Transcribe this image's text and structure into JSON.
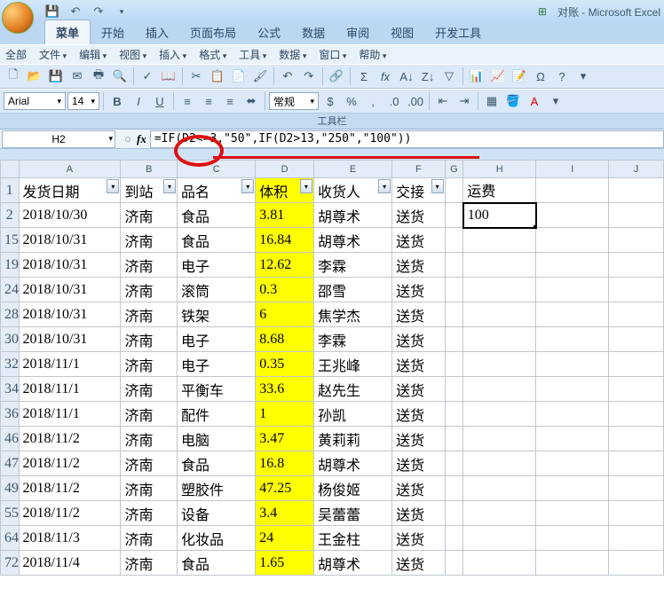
{
  "app": {
    "title_doc": "对账",
    "title_app": "Microsoft Excel"
  },
  "qat": {
    "icons": [
      "excel",
      "save",
      "undo",
      "redo",
      "down"
    ]
  },
  "ribbon": {
    "tabs": [
      "菜单",
      "开始",
      "插入",
      "页面布局",
      "公式",
      "数据",
      "审阅",
      "视图",
      "开发工具"
    ],
    "active": 0
  },
  "menu": [
    "全部",
    "文件",
    "编辑",
    "视图",
    "插入",
    "格式",
    "工具",
    "数据",
    "窗口",
    "帮助"
  ],
  "font": {
    "name": "Arial",
    "size": "14"
  },
  "toolbar_title": "工具栏",
  "number_format": "常规",
  "name_box": "H2",
  "formula": "=IF(D2<=3,\"50\",IF(D2>13,\"250\",\"100\"))",
  "headers": {
    "A": "发货日期",
    "B": "到站",
    "C": "品名",
    "D": "体积",
    "E": "收货人",
    "F": "交接",
    "H": "运费"
  },
  "columns": [
    "",
    "A",
    "B",
    "C",
    "D",
    "E",
    "F",
    "G",
    "H",
    "I",
    "J"
  ],
  "rows": [
    {
      "n": "2",
      "A": "2018/10/30",
      "B": "济南",
      "C": "食品",
      "D": "3.81",
      "E": "胡尊术",
      "F": "送货",
      "H": "100"
    },
    {
      "n": "15",
      "A": "2018/10/31",
      "B": "济南",
      "C": "食品",
      "D": "16.84",
      "E": "胡尊术",
      "F": "送货",
      "H": ""
    },
    {
      "n": "19",
      "A": "2018/10/31",
      "B": "济南",
      "C": "电子",
      "D": "12.62",
      "E": "李霖",
      "F": "送货",
      "H": ""
    },
    {
      "n": "24",
      "A": "2018/10/31",
      "B": "济南",
      "C": "滚筒",
      "D": "0.3",
      "E": "邵雪",
      "F": "送货",
      "H": ""
    },
    {
      "n": "28",
      "A": "2018/10/31",
      "B": "济南",
      "C": "铁架",
      "D": "6",
      "E": "焦学杰",
      "F": "送货",
      "H": ""
    },
    {
      "n": "30",
      "A": "2018/10/31",
      "B": "济南",
      "C": "电子",
      "D": "8.68",
      "E": "李霖",
      "F": "送货",
      "H": ""
    },
    {
      "n": "32",
      "A": "2018/11/1",
      "B": "济南",
      "C": "电子",
      "D": "0.35",
      "E": "王兆峰",
      "F": "送货",
      "H": ""
    },
    {
      "n": "34",
      "A": "2018/11/1",
      "B": "济南",
      "C": "平衡车",
      "D": "33.6",
      "E": "赵先生",
      "F": "送货",
      "H": ""
    },
    {
      "n": "36",
      "A": "2018/11/1",
      "B": "济南",
      "C": "配件",
      "D": "1",
      "E": "孙凯",
      "F": "送货",
      "H": ""
    },
    {
      "n": "46",
      "A": "2018/11/2",
      "B": "济南",
      "C": "电脑",
      "D": "3.47",
      "E": "黄莉莉",
      "F": "送货",
      "H": ""
    },
    {
      "n": "47",
      "A": "2018/11/2",
      "B": "济南",
      "C": "食品",
      "D": "16.8",
      "E": "胡尊术",
      "F": "送货",
      "H": ""
    },
    {
      "n": "49",
      "A": "2018/11/2",
      "B": "济南",
      "C": "塑胶件",
      "D": "47.25",
      "E": "杨俊姬",
      "F": "送货",
      "H": ""
    },
    {
      "n": "55",
      "A": "2018/11/2",
      "B": "济南",
      "C": "设备",
      "D": "3.4",
      "E": "吴蕾蕾",
      "F": "送货",
      "H": ""
    },
    {
      "n": "64",
      "A": "2018/11/3",
      "B": "济南",
      "C": "化妆品",
      "D": "24",
      "E": "王金柱",
      "F": "送货",
      "H": ""
    },
    {
      "n": "72",
      "A": "2018/11/4",
      "B": "济南",
      "C": "食品",
      "D": "1.65",
      "E": "胡尊术",
      "F": "送货",
      "H": ""
    }
  ],
  "chart_data": {
    "type": "table",
    "title": "运费计算表",
    "columns": [
      "发货日期",
      "到站",
      "品名",
      "体积",
      "收货人",
      "交接",
      "运费"
    ],
    "formula_rule": "运费 = IF(体积<=3, 50, IF(体积>13, 250, 100))",
    "records": [
      {
        "发货日期": "2018/10/30",
        "到站": "济南",
        "品名": "食品",
        "体积": 3.81,
        "收货人": "胡尊术",
        "交接": "送货",
        "运费": 100
      },
      {
        "发货日期": "2018/10/31",
        "到站": "济南",
        "品名": "食品",
        "体积": 16.84,
        "收货人": "胡尊术",
        "交接": "送货"
      },
      {
        "发货日期": "2018/10/31",
        "到站": "济南",
        "品名": "电子",
        "体积": 12.62,
        "收货人": "李霖",
        "交接": "送货"
      },
      {
        "发货日期": "2018/10/31",
        "到站": "济南",
        "品名": "滚筒",
        "体积": 0.3,
        "收货人": "邵雪",
        "交接": "送货"
      },
      {
        "发货日期": "2018/10/31",
        "到站": "济南",
        "品名": "铁架",
        "体积": 6,
        "收货人": "焦学杰",
        "交接": "送货"
      },
      {
        "发货日期": "2018/10/31",
        "到站": "济南",
        "品名": "电子",
        "体积": 8.68,
        "收货人": "李霖",
        "交接": "送货"
      },
      {
        "发货日期": "2018/11/1",
        "到站": "济南",
        "品名": "电子",
        "体积": 0.35,
        "收货人": "王兆峰",
        "交接": "送货"
      },
      {
        "发货日期": "2018/11/1",
        "到站": "济南",
        "品名": "平衡车",
        "体积": 33.6,
        "收货人": "赵先生",
        "交接": "送货"
      },
      {
        "发货日期": "2018/11/1",
        "到站": "济南",
        "品名": "配件",
        "体积": 1,
        "收货人": "孙凯",
        "交接": "送货"
      },
      {
        "发货日期": "2018/11/2",
        "到站": "济南",
        "品名": "电脑",
        "体积": 3.47,
        "收货人": "黄莉莉",
        "交接": "送货"
      },
      {
        "发货日期": "2018/11/2",
        "到站": "济南",
        "品名": "食品",
        "体积": 16.8,
        "收货人": "胡尊术",
        "交接": "送货"
      },
      {
        "发货日期": "2018/11/2",
        "到站": "济南",
        "品名": "塑胶件",
        "体积": 47.25,
        "收货人": "杨俊姬",
        "交接": "送货"
      },
      {
        "发货日期": "2018/11/2",
        "到站": "济南",
        "品名": "设备",
        "体积": 3.4,
        "收货人": "吴蕾蕾",
        "交接": "送货"
      },
      {
        "发货日期": "2018/11/3",
        "到站": "济南",
        "品名": "化妆品",
        "体积": 24,
        "收货人": "王金柱",
        "交接": "送货"
      },
      {
        "发货日期": "2018/11/4",
        "到站": "济南",
        "品名": "食品",
        "体积": 1.65,
        "收货人": "胡尊术",
        "交接": "送货"
      }
    ]
  }
}
